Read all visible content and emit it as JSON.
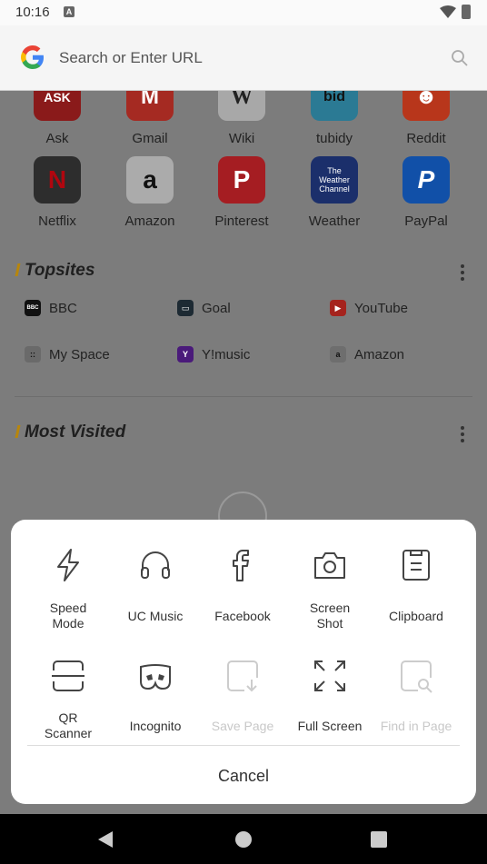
{
  "status_bar": {
    "time": "10:16"
  },
  "address_bar": {
    "placeholder": "Search or Enter URL"
  },
  "speed_dial": [
    {
      "label": "Ask",
      "color": "#c8102e"
    },
    {
      "label": "Gmail",
      "color": "#d93025"
    },
    {
      "label": "Wiki",
      "color": "#eeeeee"
    },
    {
      "label": "tubidy",
      "color": "#3aa6c9"
    },
    {
      "label": "Reddit",
      "color": "#ff4500"
    },
    {
      "label": "Netflix",
      "color": "#2a2a2a"
    },
    {
      "label": "Amazon",
      "color": "#f2f2f2"
    },
    {
      "label": "Pinterest",
      "color": "#e60023"
    },
    {
      "label": "Weather",
      "color": "#1a3b8f"
    },
    {
      "label": "PayPal",
      "color": "#0070e0"
    }
  ],
  "topsites": {
    "title": "Topsites",
    "items": [
      {
        "label": "BBC",
        "icon": "BBC"
      },
      {
        "label": "Goal",
        "icon": "G"
      },
      {
        "label": "YouTube",
        "icon": "▶"
      },
      {
        "label": "My Space",
        "icon": "::"
      },
      {
        "label": "Y!music",
        "icon": "Y"
      },
      {
        "label": "Amazon",
        "icon": "a"
      }
    ]
  },
  "most_visited": {
    "title": "Most Visited"
  },
  "menu": {
    "options": [
      {
        "label": "Speed\nMode",
        "icon": "lightning-icon",
        "disabled": false
      },
      {
        "label": "UC Music",
        "icon": "headphones-icon",
        "disabled": false
      },
      {
        "label": "Facebook",
        "icon": "facebook-icon",
        "disabled": false
      },
      {
        "label": "Screen\nShot",
        "icon": "camera-icon",
        "disabled": false
      },
      {
        "label": "Clipboard",
        "icon": "clipboard-icon",
        "disabled": false
      },
      {
        "label": "QR\nScanner",
        "icon": "scan-icon",
        "disabled": false
      },
      {
        "label": "Incognito",
        "icon": "mask-icon",
        "disabled": false
      },
      {
        "label": "Save Page",
        "icon": "save-page-icon",
        "disabled": true
      },
      {
        "label": "Full Screen",
        "icon": "fullscreen-icon",
        "disabled": false
      },
      {
        "label": "Find in Page",
        "icon": "find-in-page-icon",
        "disabled": true
      }
    ],
    "cancel_label": "Cancel"
  }
}
